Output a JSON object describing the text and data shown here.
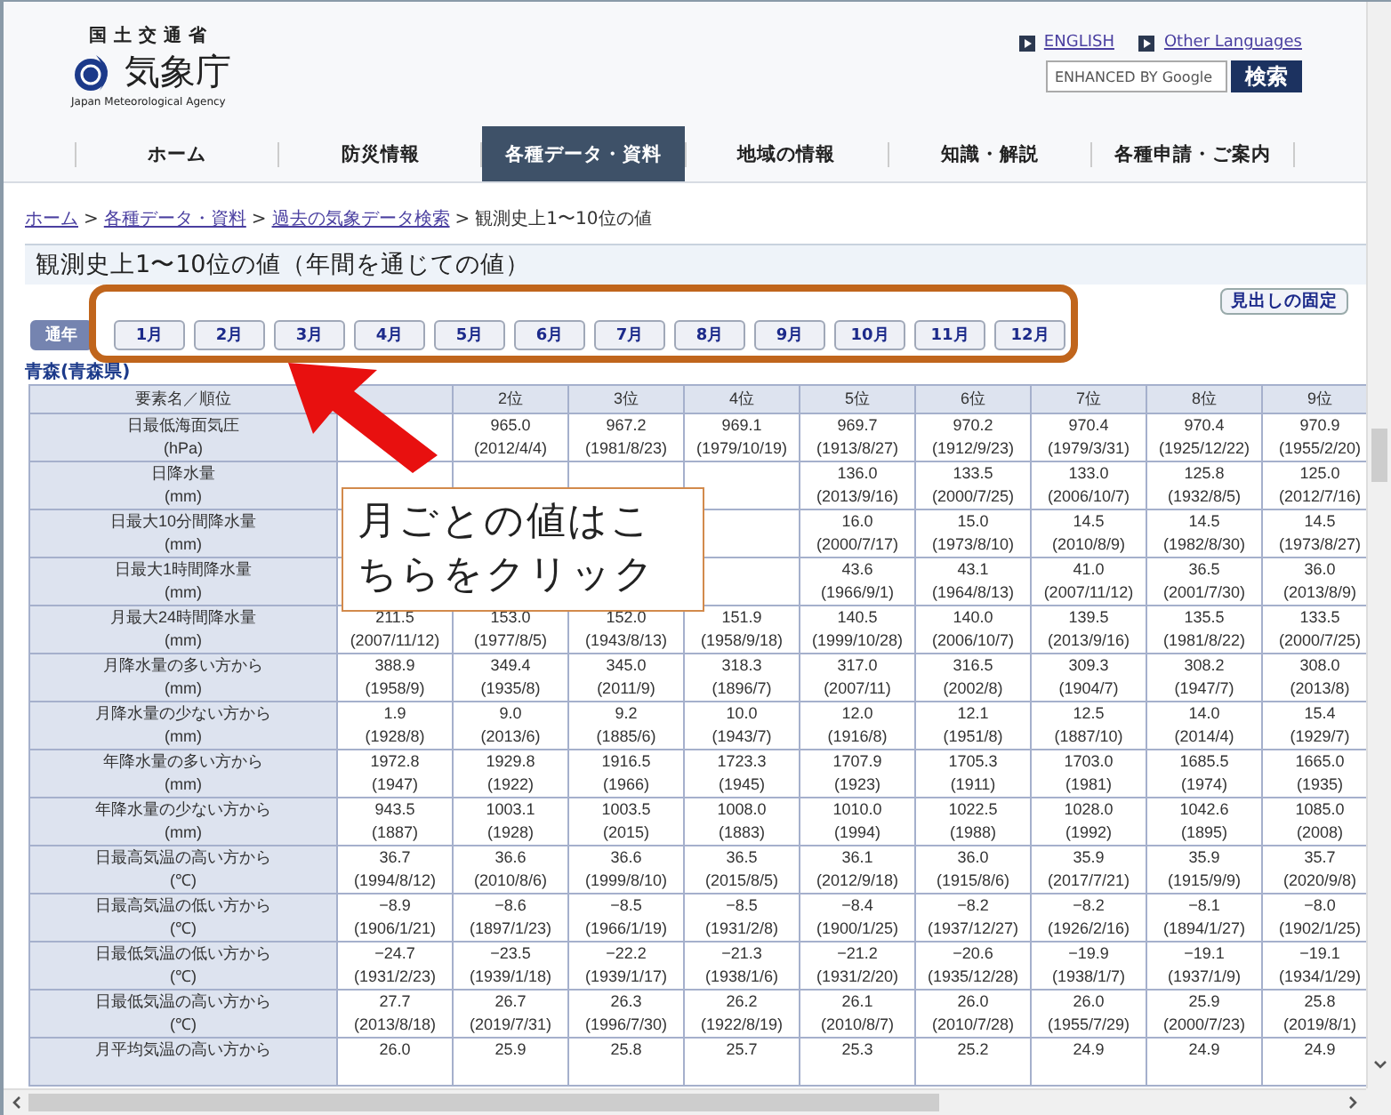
{
  "header": {
    "ministry": "国土交通省",
    "agency": "気象庁",
    "agency_en": "Japan Meteorological Agency",
    "links": [
      "ENGLISH",
      "Other Languages"
    ],
    "search": {
      "placeholder": "ENHANCED BY Google",
      "button": "検索"
    }
  },
  "nav": [
    {
      "label": "ホーム",
      "selected": false
    },
    {
      "label": "防災情報",
      "selected": false
    },
    {
      "label": "各種データ・資料",
      "selected": true
    },
    {
      "label": "地域の情報",
      "selected": false
    },
    {
      "label": "知識・解説",
      "selected": false
    },
    {
      "label": "各種申請・ご案内",
      "selected": false
    }
  ],
  "breadcrumb": {
    "links": [
      "ホーム",
      "各種データ・資料",
      "過去の気象データ検索"
    ],
    "separator": ">",
    "current": "観測史上1〜10位の値"
  },
  "title": "観測史上1〜10位の値（年間を通じての値）",
  "fix_button": "見出しの固定",
  "periods": [
    {
      "label": "通年",
      "selected": true
    },
    {
      "label": "1月",
      "selected": false
    },
    {
      "label": "2月",
      "selected": false
    },
    {
      "label": "3月",
      "selected": false
    },
    {
      "label": "4月",
      "selected": false
    },
    {
      "label": "5月",
      "selected": false
    },
    {
      "label": "6月",
      "selected": false
    },
    {
      "label": "7月",
      "selected": false
    },
    {
      "label": "8月",
      "selected": false
    },
    {
      "label": "9月",
      "selected": false
    },
    {
      "label": "10月",
      "selected": false
    },
    {
      "label": "11月",
      "selected": false
    },
    {
      "label": "12月",
      "selected": false
    }
  ],
  "station": "青森(青森県)",
  "table": {
    "name_header": "要素名／順位",
    "columns": [
      "",
      "2位",
      "3位",
      "4位",
      "5位",
      "6位",
      "7位",
      "8位",
      "9位"
    ],
    "rows": [
      {
        "name": "日最低海面気圧",
        "unit": "(hPa)",
        "cells": [
          null,
          {
            "value": "965.0",
            "date": "(2012/4/4)"
          },
          {
            "value": "967.2",
            "date": "(1981/8/23)"
          },
          {
            "value": "969.1",
            "date": "(1979/10/19)"
          },
          {
            "value": "969.7",
            "date": "(1913/8/27)"
          },
          {
            "value": "970.2",
            "date": "(1912/9/23)"
          },
          {
            "value": "970.4",
            "date": "(1979/3/31)"
          },
          {
            "value": "970.4",
            "date": "(1925/12/22)"
          },
          {
            "value": "970.9",
            "date": "(1955/2/20)"
          }
        ]
      },
      {
        "name": "日降水量",
        "unit": "(mm)",
        "cells": [
          null,
          null,
          null,
          null,
          {
            "value": "136.0",
            "date": "(2013/9/16)"
          },
          {
            "value": "133.5",
            "date": "(2000/7/25)"
          },
          {
            "value": "133.0",
            "date": "(2006/10/7)"
          },
          {
            "value": "125.8",
            "date": "(1932/8/5)"
          },
          {
            "value": "125.0",
            "date": "(2012/7/16)"
          }
        ]
      },
      {
        "name": "日最大10分間降水量",
        "unit": "(mm)",
        "cells": [
          null,
          null,
          null,
          null,
          {
            "value": "16.0",
            "date": "(2000/7/17)"
          },
          {
            "value": "15.0",
            "date": "(1973/8/10)"
          },
          {
            "value": "14.5",
            "date": "(2010/8/9)"
          },
          {
            "value": "14.5",
            "date": "(1982/8/30)"
          },
          {
            "value": "14.5",
            "date": "(1973/8/27)"
          }
        ]
      },
      {
        "name": "日最大1時間降水量",
        "unit": "(mm)",
        "cells": [
          null,
          null,
          null,
          null,
          {
            "value": "43.6",
            "date": "(1966/9/1)"
          },
          {
            "value": "43.1",
            "date": "(1964/8/13)"
          },
          {
            "value": "41.0",
            "date": "(2007/11/12)"
          },
          {
            "value": "36.5",
            "date": "(2001/7/30)"
          },
          {
            "value": "36.0",
            "date": "(2013/8/9)"
          }
        ]
      },
      {
        "name": "月最大24時間降水量",
        "unit": "(mm)",
        "cells": [
          {
            "value": "211.5",
            "date": "(2007/11/12)"
          },
          {
            "value": "153.0",
            "date": "(1977/8/5)"
          },
          {
            "value": "152.0",
            "date": "(1943/8/13)"
          },
          {
            "value": "151.9",
            "date": "(1958/9/18)"
          },
          {
            "value": "140.5",
            "date": "(1999/10/28)"
          },
          {
            "value": "140.0",
            "date": "(2006/10/7)"
          },
          {
            "value": "139.5",
            "date": "(2013/9/16)"
          },
          {
            "value": "135.5",
            "date": "(1981/8/22)"
          },
          {
            "value": "133.5",
            "date": "(2000/7/25)"
          }
        ]
      },
      {
        "name": "月降水量の多い方から",
        "unit": "(mm)",
        "cells": [
          {
            "value": "388.9",
            "date": "(1958/9)"
          },
          {
            "value": "349.4",
            "date": "(1935/8)"
          },
          {
            "value": "345.0",
            "date": "(2011/9)"
          },
          {
            "value": "318.3",
            "date": "(1896/7)"
          },
          {
            "value": "317.0",
            "date": "(2007/11)"
          },
          {
            "value": "316.5",
            "date": "(2002/8)"
          },
          {
            "value": "309.3",
            "date": "(1904/7)"
          },
          {
            "value": "308.2",
            "date": "(1947/7)"
          },
          {
            "value": "308.0",
            "date": "(2013/8)"
          }
        ]
      },
      {
        "name": "月降水量の少ない方から",
        "unit": "(mm)",
        "cells": [
          {
            "value": "1.9",
            "date": "(1928/8)"
          },
          {
            "value": "9.0",
            "date": "(2013/6)"
          },
          {
            "value": "9.2",
            "date": "(1885/6)"
          },
          {
            "value": "10.0",
            "date": "(1943/7)"
          },
          {
            "value": "12.0",
            "date": "(1916/8)"
          },
          {
            "value": "12.1",
            "date": "(1951/8)"
          },
          {
            "value": "12.5",
            "date": "(1887/10)"
          },
          {
            "value": "14.0",
            "date": "(2014/4)"
          },
          {
            "value": "15.4",
            "date": "(1929/7)"
          }
        ]
      },
      {
        "name": "年降水量の多い方から",
        "unit": "(mm)",
        "cells": [
          {
            "value": "1972.8",
            "date": "(1947)"
          },
          {
            "value": "1929.8",
            "date": "(1922)"
          },
          {
            "value": "1916.5",
            "date": "(1966)"
          },
          {
            "value": "1723.3",
            "date": "(1945)"
          },
          {
            "value": "1707.9",
            "date": "(1923)"
          },
          {
            "value": "1705.3",
            "date": "(1911)"
          },
          {
            "value": "1703.0",
            "date": "(1981)"
          },
          {
            "value": "1685.5",
            "date": "(1974)"
          },
          {
            "value": "1665.0",
            "date": "(1935)"
          }
        ]
      },
      {
        "name": "年降水量の少ない方から",
        "unit": "(mm)",
        "cells": [
          {
            "value": "943.5",
            "date": "(1887)"
          },
          {
            "value": "1003.1",
            "date": "(1928)"
          },
          {
            "value": "1003.5",
            "date": "(2015)"
          },
          {
            "value": "1008.0",
            "date": "(1883)"
          },
          {
            "value": "1010.0",
            "date": "(1994)"
          },
          {
            "value": "1022.5",
            "date": "(1988)"
          },
          {
            "value": "1028.0",
            "date": "(1992)"
          },
          {
            "value": "1042.6",
            "date": "(1895)"
          },
          {
            "value": "1085.0",
            "date": "(2008)"
          }
        ]
      },
      {
        "name": "日最高気温の高い方から",
        "unit": "(℃)",
        "cells": [
          {
            "value": "36.7",
            "date": "(1994/8/12)"
          },
          {
            "value": "36.6",
            "date": "(2010/8/6)"
          },
          {
            "value": "36.6",
            "date": "(1999/8/10)"
          },
          {
            "value": "36.5",
            "date": "(2015/8/5)"
          },
          {
            "value": "36.1",
            "date": "(2012/9/18)"
          },
          {
            "value": "36.0",
            "date": "(1915/8/6)"
          },
          {
            "value": "35.9",
            "date": "(2017/7/21)"
          },
          {
            "value": "35.9",
            "date": "(1915/9/9)"
          },
          {
            "value": "35.7",
            "date": "(2020/9/8)"
          }
        ]
      },
      {
        "name": "日最高気温の低い方から",
        "unit": "(℃)",
        "cells": [
          {
            "value": "−8.9",
            "date": "(1906/1/21)"
          },
          {
            "value": "−8.6",
            "date": "(1897/1/23)"
          },
          {
            "value": "−8.5",
            "date": "(1966/1/19)"
          },
          {
            "value": "−8.5",
            "date": "(1931/2/8)"
          },
          {
            "value": "−8.4",
            "date": "(1900/1/25)"
          },
          {
            "value": "−8.2",
            "date": "(1937/12/27)"
          },
          {
            "value": "−8.2",
            "date": "(1926/2/16)"
          },
          {
            "value": "−8.1",
            "date": "(1894/1/27)"
          },
          {
            "value": "−8.0",
            "date": "(1902/1/25)"
          }
        ]
      },
      {
        "name": "日最低気温の低い方から",
        "unit": "(℃)",
        "cells": [
          {
            "value": "−24.7",
            "date": "(1931/2/23)"
          },
          {
            "value": "−23.5",
            "date": "(1939/1/18)"
          },
          {
            "value": "−22.2",
            "date": "(1939/1/17)"
          },
          {
            "value": "−21.3",
            "date": "(1938/1/6)"
          },
          {
            "value": "−21.2",
            "date": "(1931/2/20)"
          },
          {
            "value": "−20.6",
            "date": "(1935/12/28)"
          },
          {
            "value": "−19.9",
            "date": "(1938/1/7)"
          },
          {
            "value": "−19.1",
            "date": "(1937/1/9)"
          },
          {
            "value": "−19.1",
            "date": "(1934/1/29)"
          }
        ]
      },
      {
        "name": "日最低気温の高い方から",
        "unit": "(℃)",
        "cells": [
          {
            "value": "27.7",
            "date": "(2013/8/18)"
          },
          {
            "value": "26.7",
            "date": "(2019/7/31)"
          },
          {
            "value": "26.3",
            "date": "(1996/7/30)"
          },
          {
            "value": "26.2",
            "date": "(1922/8/19)"
          },
          {
            "value": "26.1",
            "date": "(2010/8/7)"
          },
          {
            "value": "26.0",
            "date": "(2010/7/28)"
          },
          {
            "value": "26.0",
            "date": "(1955/7/29)"
          },
          {
            "value": "25.9",
            "date": "(2000/7/23)"
          },
          {
            "value": "25.8",
            "date": "(2019/8/1)"
          }
        ]
      },
      {
        "name": "月平均気温の高い方から",
        "cells": [
          {
            "value": "26.0"
          },
          {
            "value": "25.9"
          },
          {
            "value": "25.8"
          },
          {
            "value": "25.7"
          },
          {
            "value": "25.3"
          },
          {
            "value": "25.2"
          },
          {
            "value": "24.9"
          },
          {
            "value": "24.9"
          },
          {
            "value": "24.9"
          }
        ]
      }
    ]
  },
  "callout": "月ごとの値はこちらをクリック"
}
